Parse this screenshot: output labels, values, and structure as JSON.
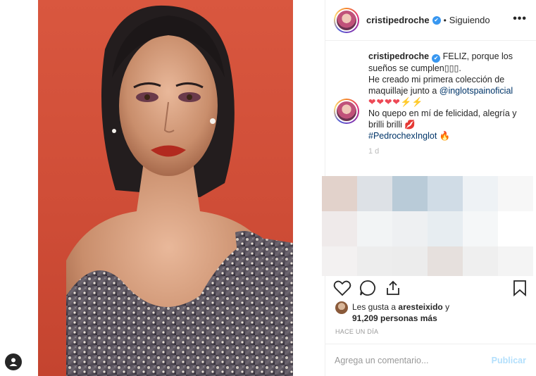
{
  "post": {
    "username": "cristipedroche",
    "verified_mark": "✔",
    "separator": "•",
    "follow_status": "Siguiendo",
    "more_icon": "•••"
  },
  "caption": {
    "username": "cristipedroche",
    "line1": " FELIZ, porque los sueños se cumplen",
    "line1_suffix": "▯▯▯.",
    "line2": "He creado mi primera colección de maquillaje junto a ",
    "mention": "@inglotspainoficial",
    "hearts": "❤❤❤❤",
    "bolts": "⚡⚡",
    "line3": "No quepo en mí de felicidad, alegría y brilli brilli ",
    "line3_emoji": "💋",
    "hashtag": "#PedrochexInglot",
    "hashtag_emoji": "🔥",
    "time": "1 d"
  },
  "likes": {
    "prefix": "Les gusta a ",
    "user": "aresteixido",
    "middle": " y",
    "count": "91,209 personas más"
  },
  "timeago": "HACE UN DÍA",
  "comment": {
    "placeholder": "Agrega un comentario...",
    "post_button": "Publicar"
  },
  "colors": {
    "accent": "#3897f0",
    "like_heart": "#ed4956",
    "photo_background": "#d9573f"
  }
}
